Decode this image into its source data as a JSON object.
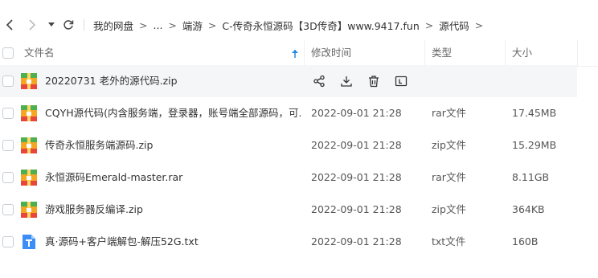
{
  "breadcrumb": [
    "我的网盘",
    "...",
    "端游",
    "C-传奇永恒源码【3D传奇】www.9417.fun",
    "源代码"
  ],
  "columns": {
    "name": "文件名",
    "modified": "修改时间",
    "type": "类型",
    "size": "大小"
  },
  "files": [
    {
      "name": "20220731 老外的源代码.zip",
      "modified": "",
      "type": "",
      "size": "",
      "icon": "zip-archive-icon",
      "hovered": true
    },
    {
      "name": "CQYH源代码(内含服务端，登录器，账号端全部源码，可...",
      "modified": "2022-09-01 21:28",
      "type": "rar文件",
      "size": "17.45MB",
      "icon": "zip-archive-icon"
    },
    {
      "name": "传奇永恒服务端源码.zip",
      "modified": "2022-09-01 21:28",
      "type": "zip文件",
      "size": "15.29MB",
      "icon": "zip-archive-icon"
    },
    {
      "name": "永恒源码Emerald-master.rar",
      "modified": "2022-09-01 21:28",
      "type": "rar文件",
      "size": "8.11GB",
      "icon": "zip-archive-icon"
    },
    {
      "name": "游戏服务器反编译.zip",
      "modified": "2022-09-01 21:28",
      "type": "zip文件",
      "size": "364KB",
      "icon": "zip-archive-icon"
    },
    {
      "name": "真·源码+客户端解包-解压52G.txt",
      "modified": "2022-09-01 21:28",
      "type": "txt文件",
      "size": "160B",
      "icon": "text-file-icon"
    }
  ],
  "colors": {
    "accent": "#1e88e5",
    "archive_orange": "#f5a623",
    "archive_green": "#4caf50",
    "txt_blue": "#3a8ef6",
    "hover_row": "#f5f6f8"
  }
}
